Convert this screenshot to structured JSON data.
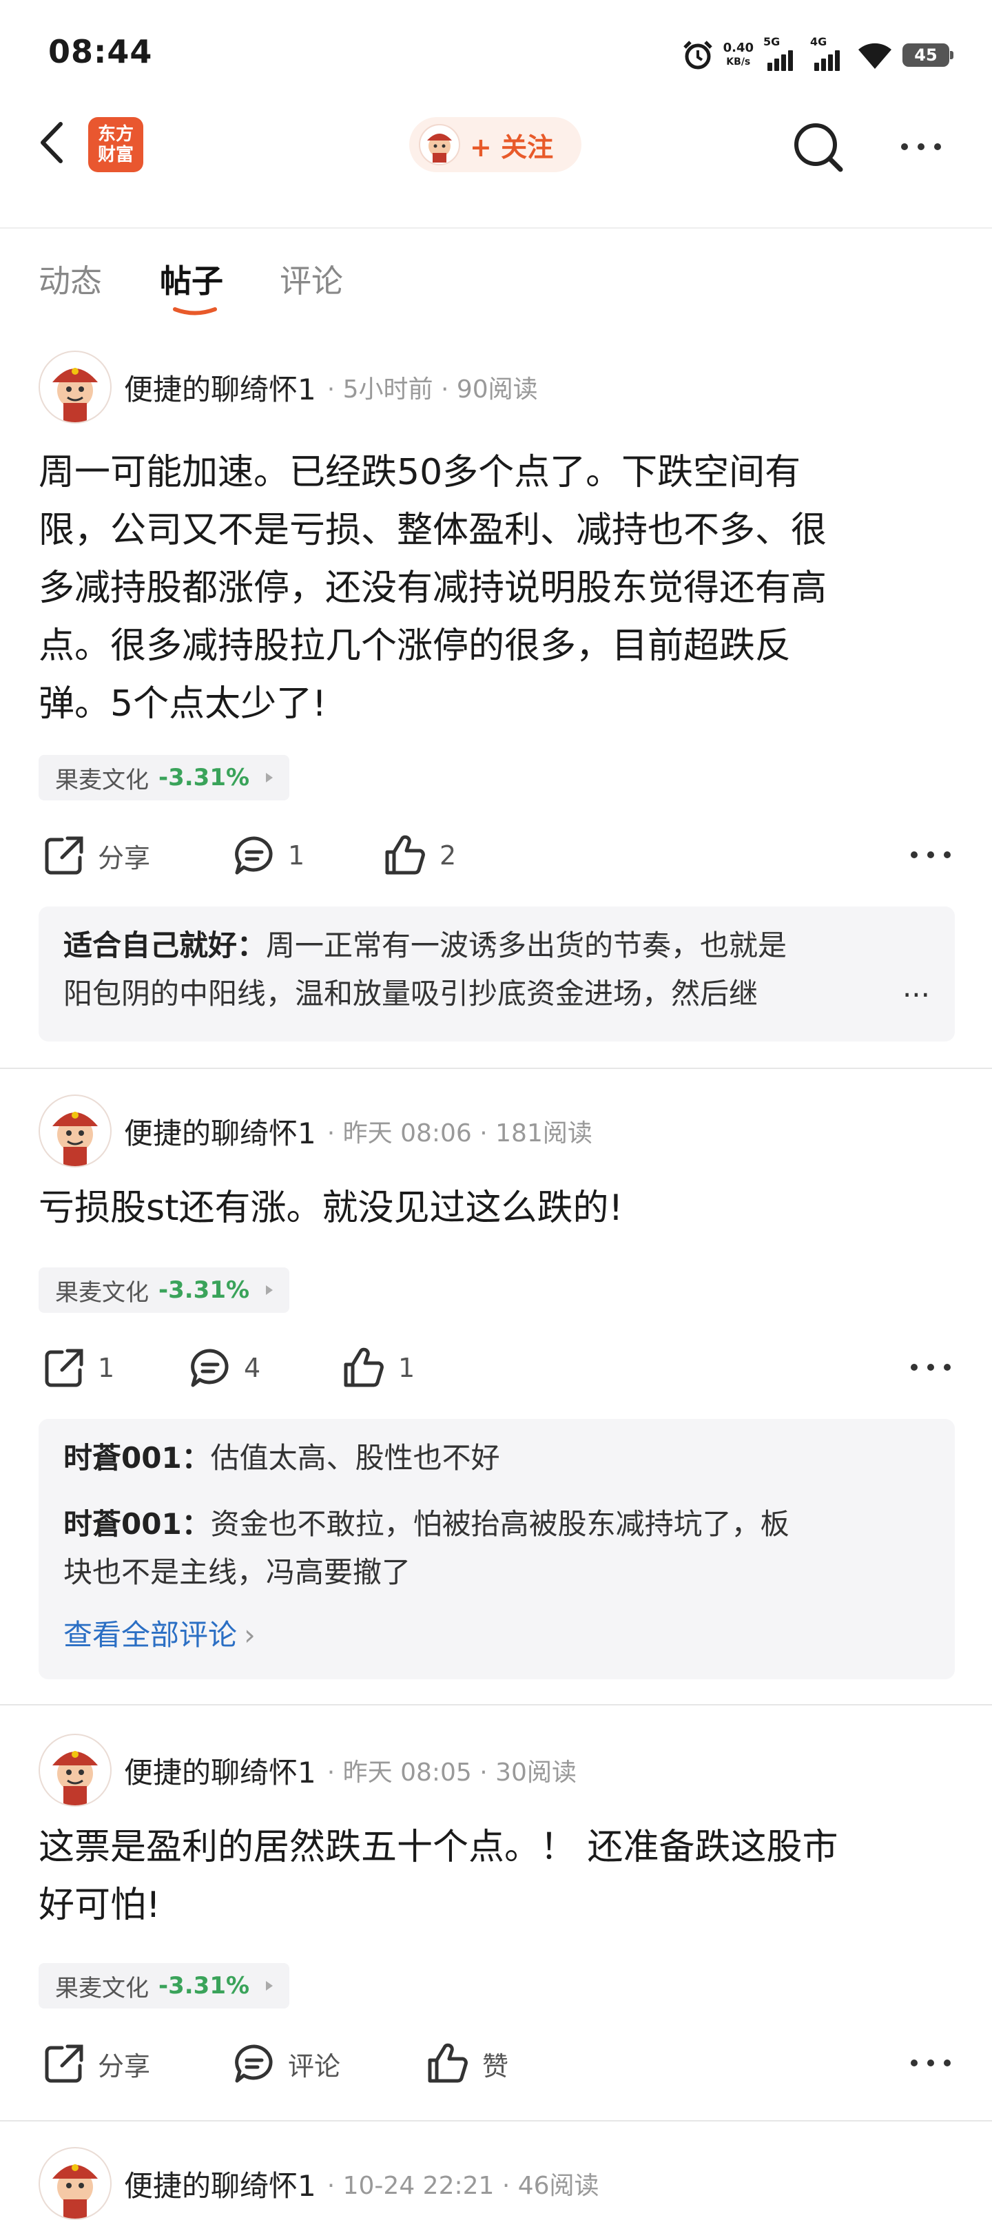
{
  "status_bar": {
    "time": "08:44",
    "net_speed_value": "0.40",
    "net_speed_unit": "KB/s",
    "signal1": "5G",
    "signal2": "4G",
    "battery": "45"
  },
  "nav": {
    "logo_line1": "东方",
    "logo_line2": "财富",
    "follow_label": "+ 关注"
  },
  "tabs": [
    {
      "label": "动态",
      "active": false
    },
    {
      "label": "帖子",
      "active": true
    },
    {
      "label": "评论",
      "active": false
    }
  ],
  "accent_color": "#e85a2a",
  "down_color": "#3aa35a",
  "posts": [
    {
      "author": "便捷的聊绮怀1",
      "meta": "· 5小时前 · 90阅读",
      "lines": [
        "周一可能加速。已经跌50多个点了。下跌空间有",
        "限，公司又不是亏损、整体盈利、减持也不多、很",
        "多减持股都涨停，还没有减持说明股东觉得还有高",
        "点。很多减持股拉几个涨停的很多，目前超跌反",
        "弹。5个点太少了!"
      ],
      "stock": {
        "name": "果麦文化",
        "change": "-3.31%"
      },
      "share_label": "分享",
      "comment_label": "1",
      "like_label": "2",
      "comments": [
        {
          "user": "适合自己就好：",
          "line1": "周一正常有一波诱多出货的节奏，也就是",
          "line2": "阳包阴的中阳线，温和放量吸引抄底资金进场，然后继",
          "ellipsis": "..."
        }
      ]
    },
    {
      "author": "便捷的聊绮怀1",
      "meta": "· 昨天 08:06 · 181阅读",
      "lines": [
        "亏损股st还有涨。就没见过这么跌的!"
      ],
      "stock": {
        "name": "果麦文化",
        "change": "-3.31%"
      },
      "share_label": "1",
      "comment_label": "4",
      "like_label": "1",
      "comments": [
        {
          "user": "时蒼001：",
          "line1": "估值太高、股性也不好"
        },
        {
          "user": "时蒼001：",
          "line1": "资金也不敢拉，怕被抬高被股东减持坑了，板",
          "line2": "块也不是主线，冯高要撤了"
        }
      ],
      "view_all": "查看全部评论"
    },
    {
      "author": "便捷的聊绮怀1",
      "meta": "· 昨天 08:05 · 30阅读",
      "lines": [
        "这票是盈利的居然跌五十个点。！ 还准备跌这股市",
        "好可怕!"
      ],
      "stock": {
        "name": "果麦文化",
        "change": "-3.31%"
      },
      "share_label": "分享",
      "comment_label": "评论",
      "like_label": "赞"
    },
    {
      "author": "便捷的聊绮怀1",
      "meta": "· 10-24 22:21 · 46阅读"
    }
  ]
}
